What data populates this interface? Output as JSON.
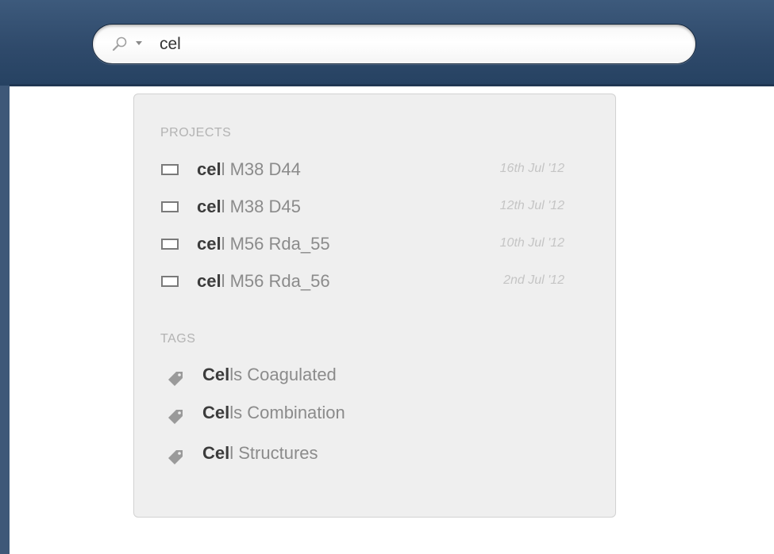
{
  "search": {
    "value": "cel",
    "icon": "search-icon",
    "dropdown_icon": "chevron-down-icon"
  },
  "dropdown": {
    "projects_heading": "PROJECTS",
    "projects": [
      {
        "match": "cel",
        "rest": "l M38 D44",
        "date": "16th Jul '12",
        "icon": "project-icon"
      },
      {
        "match": "cel",
        "rest": "l M38 D45",
        "date": "12th Jul '12",
        "icon": "project-icon"
      },
      {
        "match": "cel",
        "rest": "l M56 Rda_55",
        "date": "10th Jul '12",
        "icon": "project-icon"
      },
      {
        "match": "cel",
        "rest": "l M56 Rda_56",
        "date": "2nd Jul '12",
        "icon": "project-icon"
      }
    ],
    "tags_heading": "TAGS",
    "tags": [
      {
        "match": "Cel",
        "rest": "ls Coagulated",
        "icon": "tag-icon"
      },
      {
        "match": "Cel",
        "rest": "ls Combination",
        "icon": "tag-icon"
      },
      {
        "match": "Cel",
        "rest": "l Structures",
        "icon": "tag-icon"
      }
    ]
  },
  "colors": {
    "header": "#2f4a6b",
    "frame": "#3e5878",
    "dropdown_bg": "#efefef",
    "match_text": "#3c3c3c",
    "rest_text": "#8b8b8b",
    "date_text": "#c5c5c5"
  }
}
